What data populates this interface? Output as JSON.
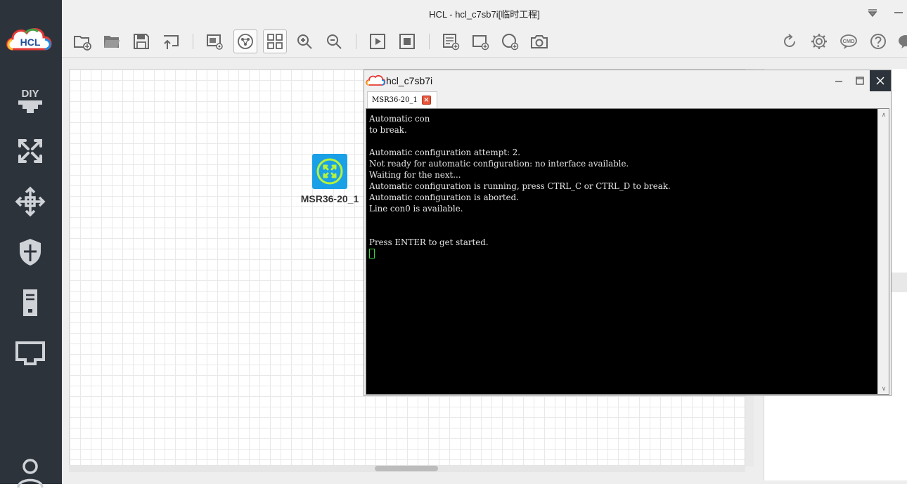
{
  "app": {
    "window_title": "HCL - hcl_c7sb7i[临时工程]",
    "logo_text": "HCL"
  },
  "sidebar": {
    "items": [
      {
        "name": "diy-icon"
      },
      {
        "name": "router-category-icon"
      },
      {
        "name": "switch-category-icon"
      },
      {
        "name": "firewall-category-icon"
      },
      {
        "name": "server-category-icon"
      },
      {
        "name": "connection-category-icon"
      },
      {
        "name": "user-icon"
      }
    ]
  },
  "toolbar": {
    "buttons": [
      "new-project-icon",
      "open-project-icon",
      "save-icon",
      "export-icon",
      "capture-view-icon",
      "topology-icon",
      "grid-toggle-icon",
      "zoom-in-icon",
      "zoom-out-icon",
      "start-icon",
      "stop-icon",
      "add-note-icon",
      "add-rect-icon",
      "add-ellipse-icon",
      "screenshot-icon",
      "refresh-icon",
      "settings-icon",
      "cmd-icon",
      "help-icon",
      "feedback-icon"
    ],
    "cmd_label": "CMD"
  },
  "canvas": {
    "device": {
      "label": "MSR36-20_1",
      "icon": "router-icon",
      "color": "#1aa0e6"
    }
  },
  "console": {
    "title": "hcl_c7sb7i",
    "tab_label": "MSR36-20_1",
    "terminal_text": "Automatic con\nto break.\n\nAutomatic configuration attempt: 2.\nNot ready for automatic configuration: no interface available.\nWaiting for the next...\nAutomatic configuration is running, press CTRL_C or CTRL_D to break.\nAutomatic configuration is aborted.\nLine con0 is available.\n\n\nPress ENTER to get started.",
    "cursor_color": "#3dd43d"
  },
  "colors": {
    "sidebar_bg": "#2d333b",
    "toolbar_bg": "#f0f0f0",
    "terminal_bg": "#000000",
    "terminal_fg": "#e6e6e6",
    "accent": "#1aa0e6"
  }
}
